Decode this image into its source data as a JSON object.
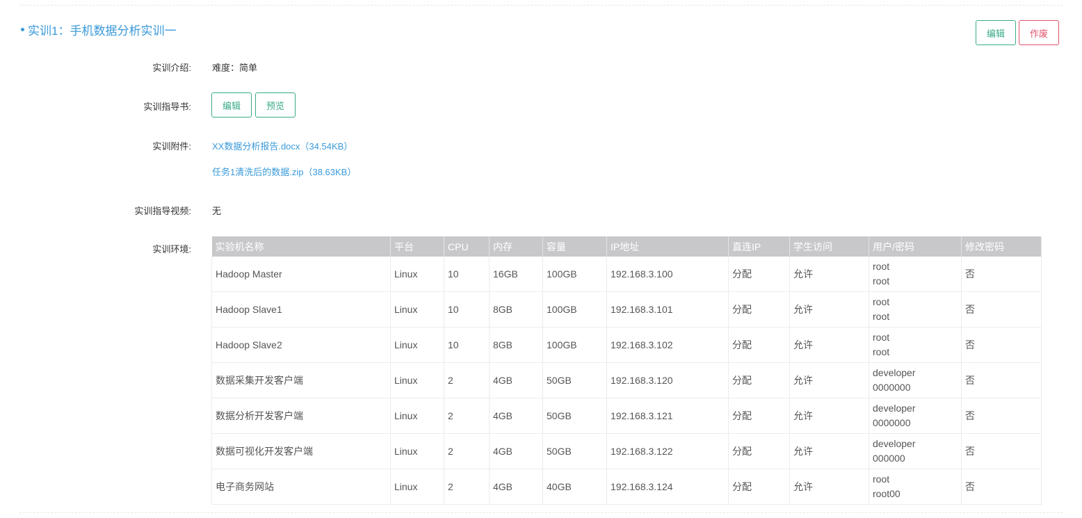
{
  "section": {
    "title": "实训1：手机数据分析实训一",
    "edit_label": "编辑",
    "void_label": "作废"
  },
  "intro": {
    "label": "实训介绍:",
    "value": "难度：简单"
  },
  "guide": {
    "label": "实训指导书:",
    "edit_label": "编辑",
    "preview_label": "预览"
  },
  "attachments": {
    "label": "实训附件:",
    "files": [
      "XX数据分析报告.docx（34.54KB）",
      "任务1清洗后的数据.zip（38.63KB）"
    ]
  },
  "video": {
    "label": "实训指导视频:",
    "value": "无"
  },
  "environment": {
    "label": "实训环境:",
    "columns": [
      "实验机名称",
      "平台",
      "CPU",
      "内存",
      "容量",
      "IP地址",
      "直连IP",
      "学生访问",
      "用户/密码",
      "修改密码"
    ],
    "rows": [
      {
        "name": "Hadoop Master",
        "platform": "Linux",
        "cpu": "10",
        "memory": "16GB",
        "capacity": "100GB",
        "ip": "192.168.3.100",
        "direct_ip": "分配",
        "student_access": "允许",
        "user": "root",
        "password": "root",
        "change_password": "否"
      },
      {
        "name": "Hadoop Slave1",
        "platform": "Linux",
        "cpu": "10",
        "memory": "8GB",
        "capacity": "100GB",
        "ip": "192.168.3.101",
        "direct_ip": "分配",
        "student_access": "允许",
        "user": "root",
        "password": "root",
        "change_password": "否"
      },
      {
        "name": "Hadoop Slave2",
        "platform": "Linux",
        "cpu": "10",
        "memory": "8GB",
        "capacity": "100GB",
        "ip": "192.168.3.102",
        "direct_ip": "分配",
        "student_access": "允许",
        "user": "root",
        "password": "root",
        "change_password": "否"
      },
      {
        "name": "数据采集开发客户端",
        "platform": "Linux",
        "cpu": "2",
        "memory": "4GB",
        "capacity": "50GB",
        "ip": "192.168.3.120",
        "direct_ip": "分配",
        "student_access": "允许",
        "user": "developer",
        "password": "0000000",
        "change_password": "否"
      },
      {
        "name": "数据分析开发客户端",
        "platform": "Linux",
        "cpu": "2",
        "memory": "4GB",
        "capacity": "50GB",
        "ip": "192.168.3.121",
        "direct_ip": "分配",
        "student_access": "允许",
        "user": "developer",
        "password": "0000000",
        "change_password": "否"
      },
      {
        "name": "数据可视化开发客户端",
        "platform": "Linux",
        "cpu": "2",
        "memory": "4GB",
        "capacity": "50GB",
        "ip": "192.168.3.122",
        "direct_ip": "分配",
        "student_access": "允许",
        "user": "developer",
        "password": "000000",
        "change_password": "否"
      },
      {
        "name": "电子商务网站",
        "platform": "Linux",
        "cpu": "2",
        "memory": "4GB",
        "capacity": "40GB",
        "ip": "192.168.3.124",
        "direct_ip": "分配",
        "student_access": "允许",
        "user": "root",
        "password": "root00",
        "change_password": "否"
      }
    ]
  },
  "colors": {
    "title_blue": "#3a9ad9",
    "edit_green": "#3aaa8a",
    "void_red": "#e05068",
    "header_gray": "#c8c8cb"
  }
}
